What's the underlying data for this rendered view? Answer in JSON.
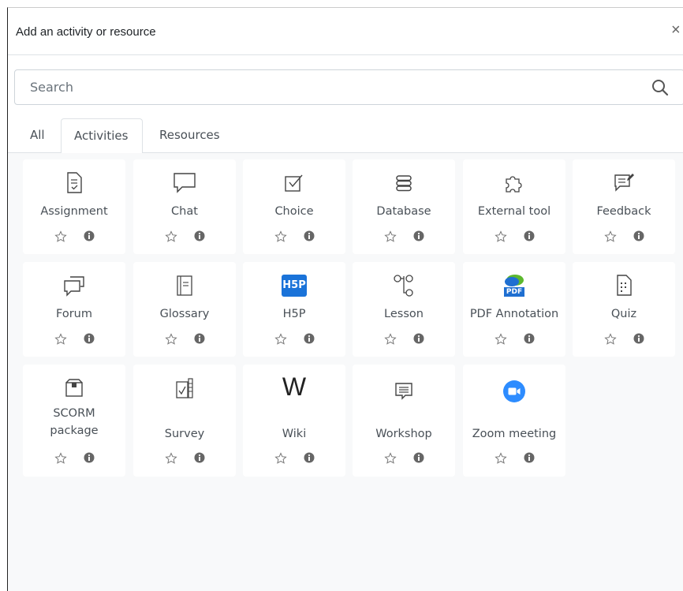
{
  "modal": {
    "title": "Add an activity or resource",
    "close_glyph": "×"
  },
  "search": {
    "placeholder": "Search",
    "icon": "search-icon"
  },
  "tabs": [
    {
      "label": "All",
      "active": false
    },
    {
      "label": "Activities",
      "active": true
    },
    {
      "label": "Resources",
      "active": false
    }
  ],
  "items": [
    {
      "label": "Assignment",
      "icon": "assignment-icon"
    },
    {
      "label": "Chat",
      "icon": "chat-icon"
    },
    {
      "label": "Choice",
      "icon": "choice-icon"
    },
    {
      "label": "Database",
      "icon": "database-icon"
    },
    {
      "label": "External tool",
      "icon": "puzzle-icon"
    },
    {
      "label": "Feedback",
      "icon": "feedback-icon"
    },
    {
      "label": "Forum",
      "icon": "forum-icon"
    },
    {
      "label": "Glossary",
      "icon": "glossary-icon"
    },
    {
      "label": "H5P",
      "icon": "h5p-icon",
      "icon_text": "H5P"
    },
    {
      "label": "Lesson",
      "icon": "lesson-icon"
    },
    {
      "label": "PDF Annotation",
      "icon": "pdf-annotation-icon",
      "icon_text": "PDF"
    },
    {
      "label": "Quiz",
      "icon": "quiz-icon"
    },
    {
      "label": "SCORM package",
      "label_lines": [
        "SCORM",
        "package"
      ],
      "icon": "scorm-package-icon"
    },
    {
      "label": "Survey",
      "icon": "survey-icon"
    },
    {
      "label": "Wiki",
      "icon": "wiki-icon",
      "icon_text": "W"
    },
    {
      "label": "Workshop",
      "icon": "workshop-icon"
    },
    {
      "label": "Zoom meeting",
      "icon": "zoom-camera-icon"
    }
  ],
  "colors": {
    "h5p": "#1a73d9",
    "zoom": "#2d8cff",
    "pdf_blue": "#1f6fd1",
    "pdf_green": "#5cb82e"
  }
}
